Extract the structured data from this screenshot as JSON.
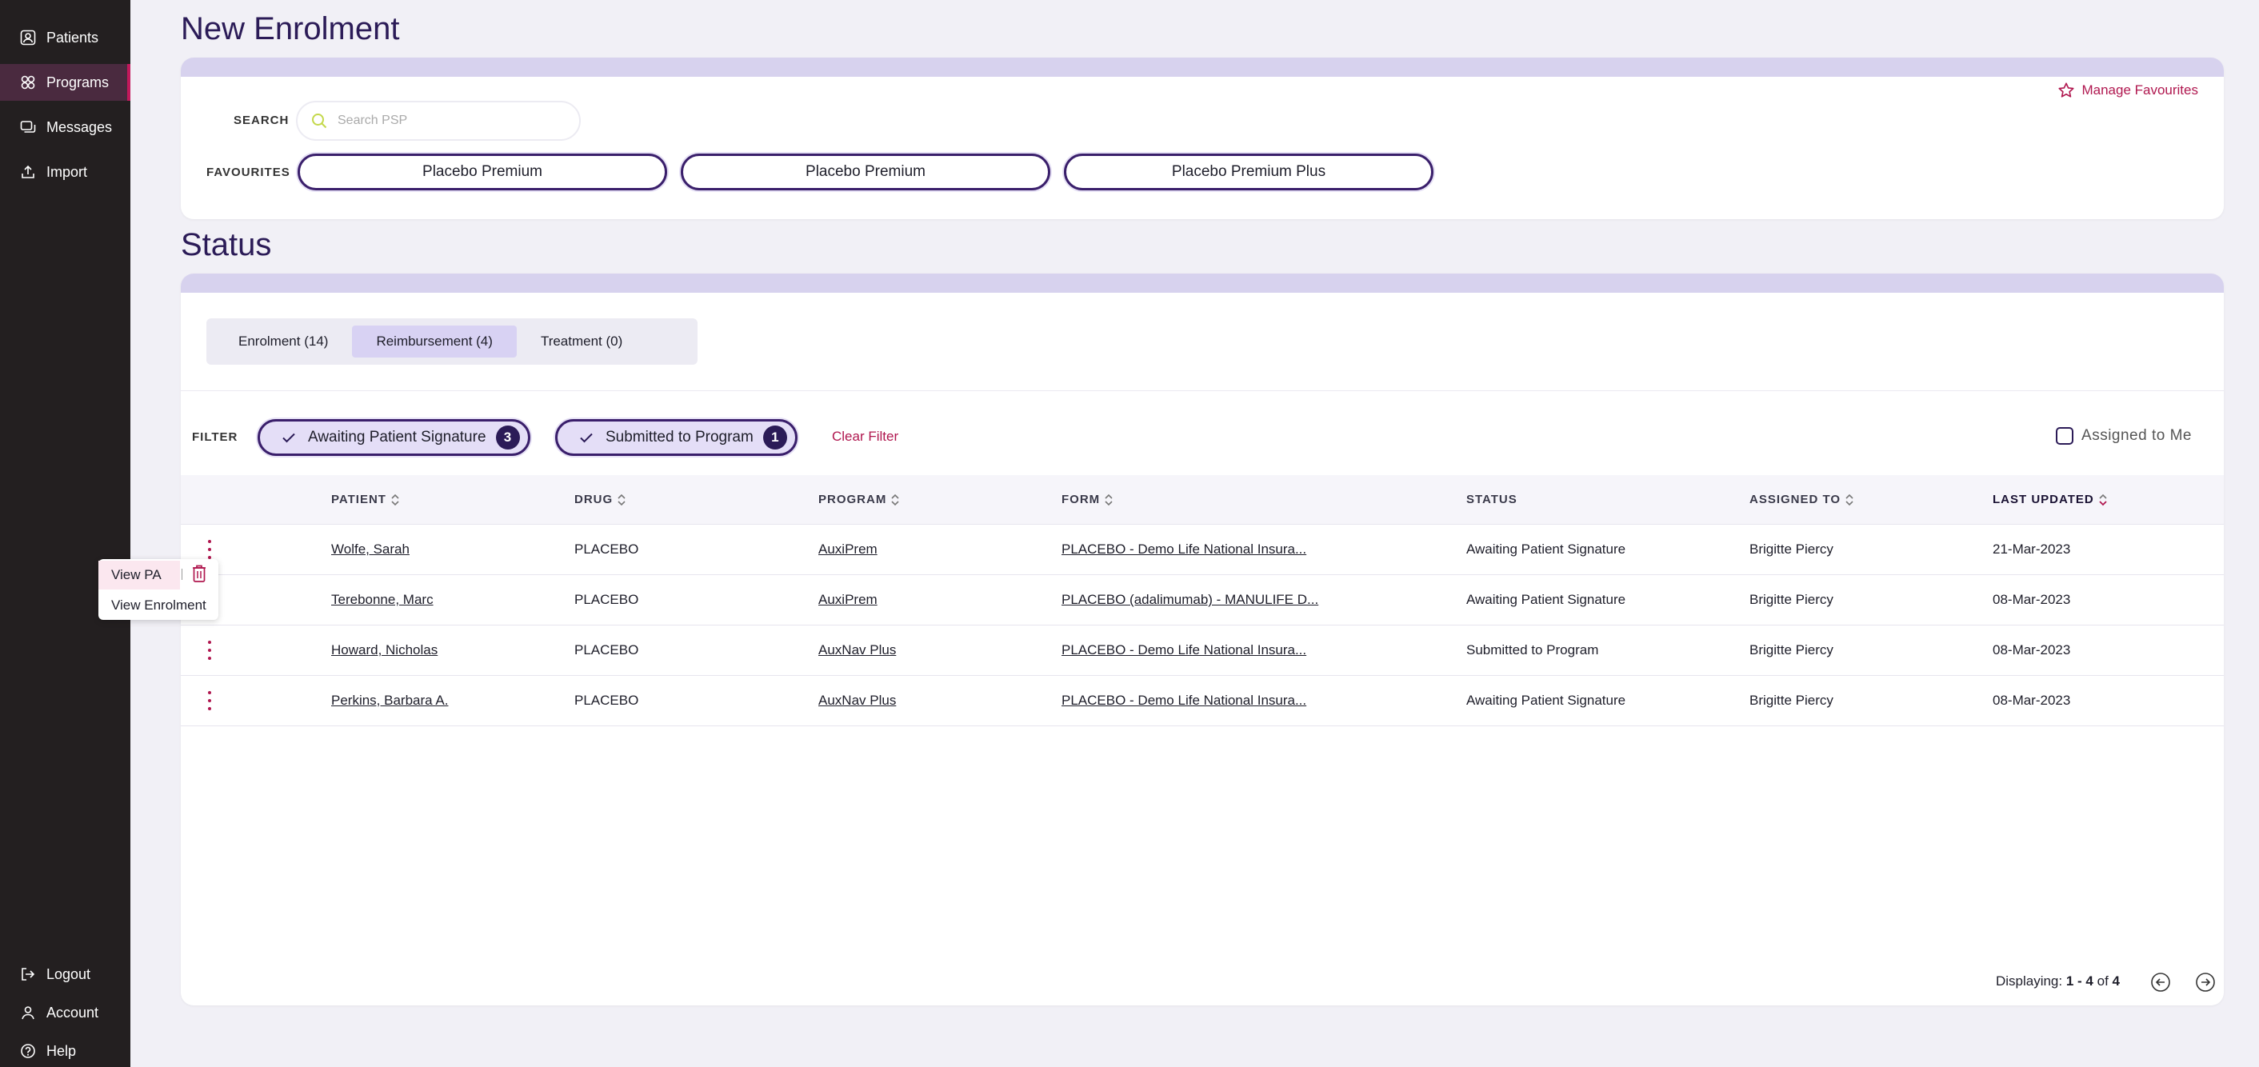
{
  "sidebar": {
    "items": [
      {
        "label": "Patients",
        "icon": "patients-icon"
      },
      {
        "label": "Programs",
        "icon": "programs-icon",
        "active": true
      },
      {
        "label": "Messages",
        "icon": "messages-icon"
      },
      {
        "label": "Import",
        "icon": "import-icon"
      }
    ],
    "bottom": [
      {
        "label": "Logout",
        "icon": "logout-icon"
      },
      {
        "label": "Account",
        "icon": "account-icon"
      },
      {
        "label": "Help",
        "icon": "help-icon"
      }
    ]
  },
  "page_title": "New Enrolment",
  "search": {
    "label": "SEARCH",
    "placeholder": "Search PSP"
  },
  "favourites": {
    "label": "FAVOURITES",
    "items": [
      "Placebo Premium",
      "Placebo Premium",
      "Placebo Premium Plus"
    ],
    "manage_label": "Manage Favourites"
  },
  "status_title": "Status",
  "tabs": [
    {
      "label": "Enrolment (14)"
    },
    {
      "label": "Reimbursement (4)",
      "active": true
    },
    {
      "label": "Treatment (0)"
    }
  ],
  "filter": {
    "label": "FILTER",
    "chips": [
      {
        "label": "Awaiting Patient Signature",
        "count": "3"
      },
      {
        "label": "Submitted to Program",
        "count": "1"
      }
    ],
    "clear_label": "Clear Filter",
    "assigned_label": "Assigned to Me"
  },
  "table": {
    "columns": [
      "PATIENT",
      "DRUG",
      "PROGRAM",
      "FORM",
      "STATUS",
      "ASSIGNED TO",
      "LAST UPDATED"
    ],
    "rows": [
      {
        "patient": "Wolfe, Sarah",
        "drug": "PLACEBO",
        "program": "AuxiPrem",
        "form": "PLACEBO - Demo Life National Insura...",
        "status": "Awaiting Patient Signature",
        "assigned": "Brigitte Piercy",
        "updated": "21-Mar-2023"
      },
      {
        "patient": "Terebonne, Marc",
        "drug": "PLACEBO",
        "program": "AuxiPrem",
        "form": "PLACEBO (adalimumab) - MANULIFE D...",
        "status": "Awaiting Patient Signature",
        "assigned": "Brigitte Piercy",
        "updated": "08-Mar-2023"
      },
      {
        "patient": "Howard, Nicholas",
        "drug": "PLACEBO",
        "program": "AuxNav Plus",
        "form": "PLACEBO - Demo Life National Insura...",
        "status": "Submitted to Program",
        "assigned": "Brigitte Piercy",
        "updated": "08-Mar-2023"
      },
      {
        "patient": "Perkins, Barbara A.",
        "drug": "PLACEBO",
        "program": "AuxNav Plus",
        "form": "PLACEBO - Demo Life National Insura...",
        "status": "Awaiting Patient Signature",
        "assigned": "Brigitte Piercy",
        "updated": "08-Mar-2023"
      }
    ]
  },
  "context_menu": {
    "view_pa": "View PA",
    "view_enrolment": "View Enrolment"
  },
  "pager": {
    "prefix": "Displaying:",
    "range": "1 - 4",
    "of": "of",
    "total": "4"
  },
  "colors": {
    "sidebar": "#231f20",
    "accent": "#b0174f",
    "primary": "#2b1b57",
    "band": "#d7d2ee"
  }
}
